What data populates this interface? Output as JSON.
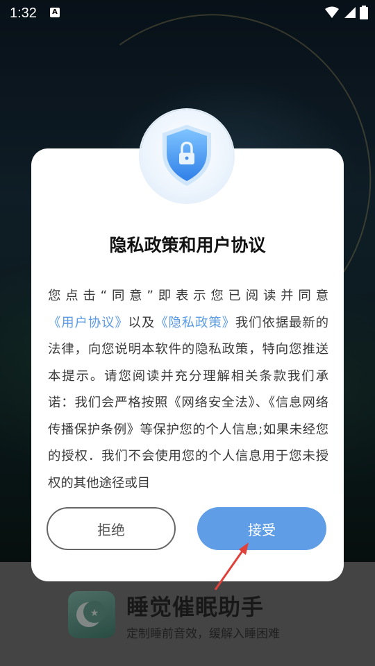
{
  "status_bar": {
    "time": "1:32",
    "notification_icon": "A"
  },
  "dialog": {
    "title": "隐私政策和用户协议",
    "body_segments": [
      {
        "text": "您点击“同意”即表示您已阅读并同意",
        "link": false
      },
      {
        "text": "《用户协议》",
        "link": true
      },
      {
        "text": "以及",
        "link": false
      },
      {
        "text": "《隐私政策》",
        "link": true
      },
      {
        "text": "我们依据最新的法律，向您说明本软件的隐私政策，特向您推送本提示。请您阅读并充分理解相关条款我们承诺：我们会严格按照《网络安全法》、《信息网络传播保护条例》等保护您的个人信息;如果未经您的授权．我们不会使用您的个人信息用于您未授权的其他途径或目",
        "link": false
      }
    ],
    "reject_label": "拒绝",
    "accept_label": "接受"
  },
  "app": {
    "name": "睡觉催眠助手",
    "slogan": "定制睡前音效，缓解入睡困难"
  },
  "colors": {
    "accent": "#5f9ee6",
    "arrow": "#e0413a"
  }
}
